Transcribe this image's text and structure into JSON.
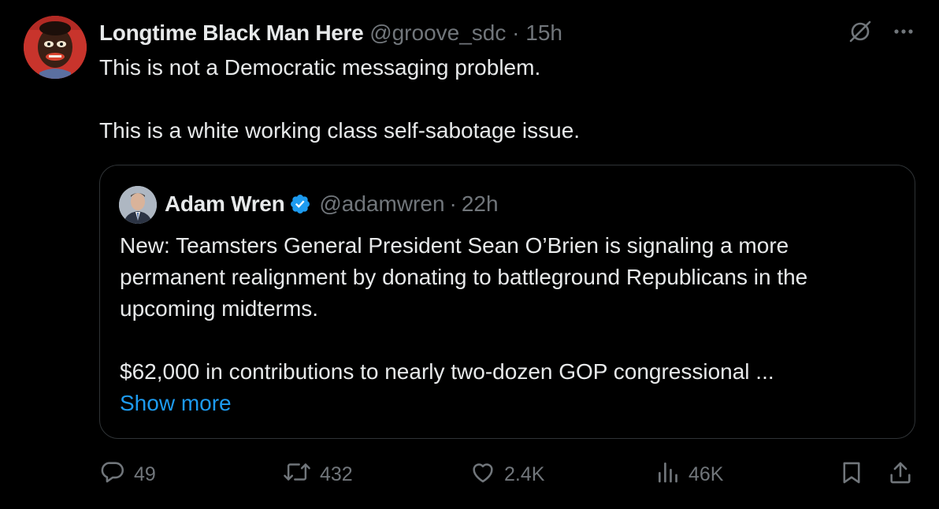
{
  "author": {
    "name": "Longtime Black Man Here",
    "handle": "@groove_sdc",
    "separator": "·",
    "time": "15h"
  },
  "tweet": {
    "paragraphs": [
      "This is not a Democratic messaging problem.",
      "This is a white working class self-sabotage issue."
    ]
  },
  "quote": {
    "name": "Adam Wren",
    "handle": "@adamwren",
    "separator": "·",
    "time": "22h",
    "verified": true,
    "paragraphs": [
      "New: Teamsters General President Sean O’Brien is signaling a more permanent realignment by donating to battleground Republicans in the upcoming midterms.",
      "$62,000 in contributions to nearly two-dozen GOP congressional ..."
    ],
    "show_more": "Show more"
  },
  "actions": {
    "replies": "49",
    "reposts": "432",
    "likes": "2.4K",
    "views": "46K"
  },
  "colors": {
    "background": "#000000",
    "text": "#e7e9ea",
    "secondary": "#71767b",
    "accent": "#1d9bf0",
    "border": "#2f3336"
  },
  "icons": [
    "grok-icon",
    "more-icon",
    "verified-badge-icon",
    "reply-icon",
    "repost-icon",
    "like-icon",
    "views-icon",
    "bookmark-icon",
    "share-icon"
  ]
}
